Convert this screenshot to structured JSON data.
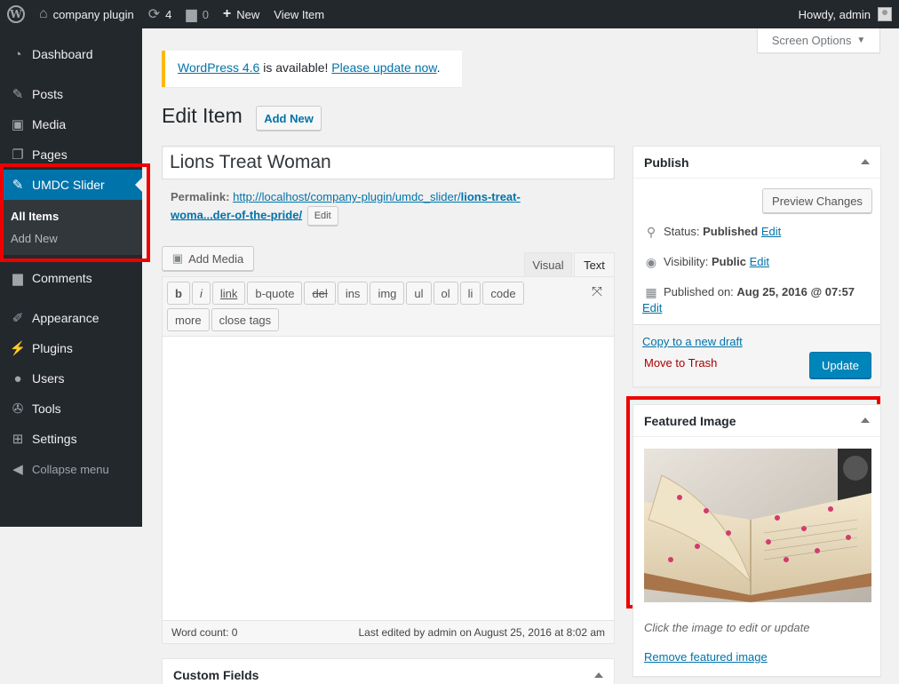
{
  "adminbar": {
    "site_name": "company plugin",
    "updates_count": "4",
    "comments_count": "0",
    "new_label": "New",
    "view_item_label": "View Item",
    "howdy": "Howdy, admin"
  },
  "sidebar": {
    "items": [
      {
        "label": "Dashboard",
        "icon": "dashboard-icon"
      },
      {
        "label": "Posts",
        "icon": "pin-icon"
      },
      {
        "label": "Media",
        "icon": "media-icon"
      },
      {
        "label": "Pages",
        "icon": "pages-icon"
      },
      {
        "label": "UMDC Slider",
        "icon": "pin-icon"
      },
      {
        "label": "Comments",
        "icon": "comment-icon"
      },
      {
        "label": "Appearance",
        "icon": "brush-icon"
      },
      {
        "label": "Plugins",
        "icon": "plugin-icon"
      },
      {
        "label": "Users",
        "icon": "user-icon"
      },
      {
        "label": "Tools",
        "icon": "wrench-icon"
      },
      {
        "label": "Settings",
        "icon": "settings-icon"
      }
    ],
    "submenu": [
      "All Items",
      "Add New"
    ],
    "collapse_label": "Collapse menu",
    "current_color": "#0073aa"
  },
  "screen_options": "Screen Options",
  "notice": {
    "link1": "WordPress 4.6",
    "middle": " is available! ",
    "link2": "Please update now",
    "end": "."
  },
  "page": {
    "title": "Edit Item",
    "add_new": "Add New"
  },
  "editor": {
    "post_title": "Lions Treat Woman",
    "permalink_label": "Permalink:",
    "permalink_base": "http://localhost/company-plugin/umdc_slider/",
    "permalink_slug": "lions-treat-woma...der-of-the-pride/",
    "permalink_edit": "Edit",
    "add_media": "Add Media",
    "tab_visual": "Visual",
    "tab_text": "Text",
    "quicktags": [
      "b",
      "i",
      "link",
      "b-quote",
      "del",
      "ins",
      "img",
      "ul",
      "ol",
      "li",
      "code"
    ],
    "quicktags_row2": [
      "more",
      "close tags"
    ],
    "word_count": "Word count: 0",
    "last_edited": "Last edited by admin on August 25, 2016 at 8:02 am"
  },
  "custom_fields": {
    "title": "Custom Fields"
  },
  "publish": {
    "title": "Publish",
    "preview": "Preview Changes",
    "status_label": "Status:",
    "status_value": "Published",
    "visibility_label": "Visibility:",
    "visibility_value": "Public",
    "published_label": "Published on:",
    "published_value": "Aug 25, 2016 @ 07:57",
    "edit": "Edit",
    "copy_draft": "Copy to a new draft",
    "trash": "Move to Trash",
    "update": "Update"
  },
  "featured": {
    "title": "Featured Image",
    "caption": "Click the image to edit or update",
    "remove": "Remove featured image"
  }
}
